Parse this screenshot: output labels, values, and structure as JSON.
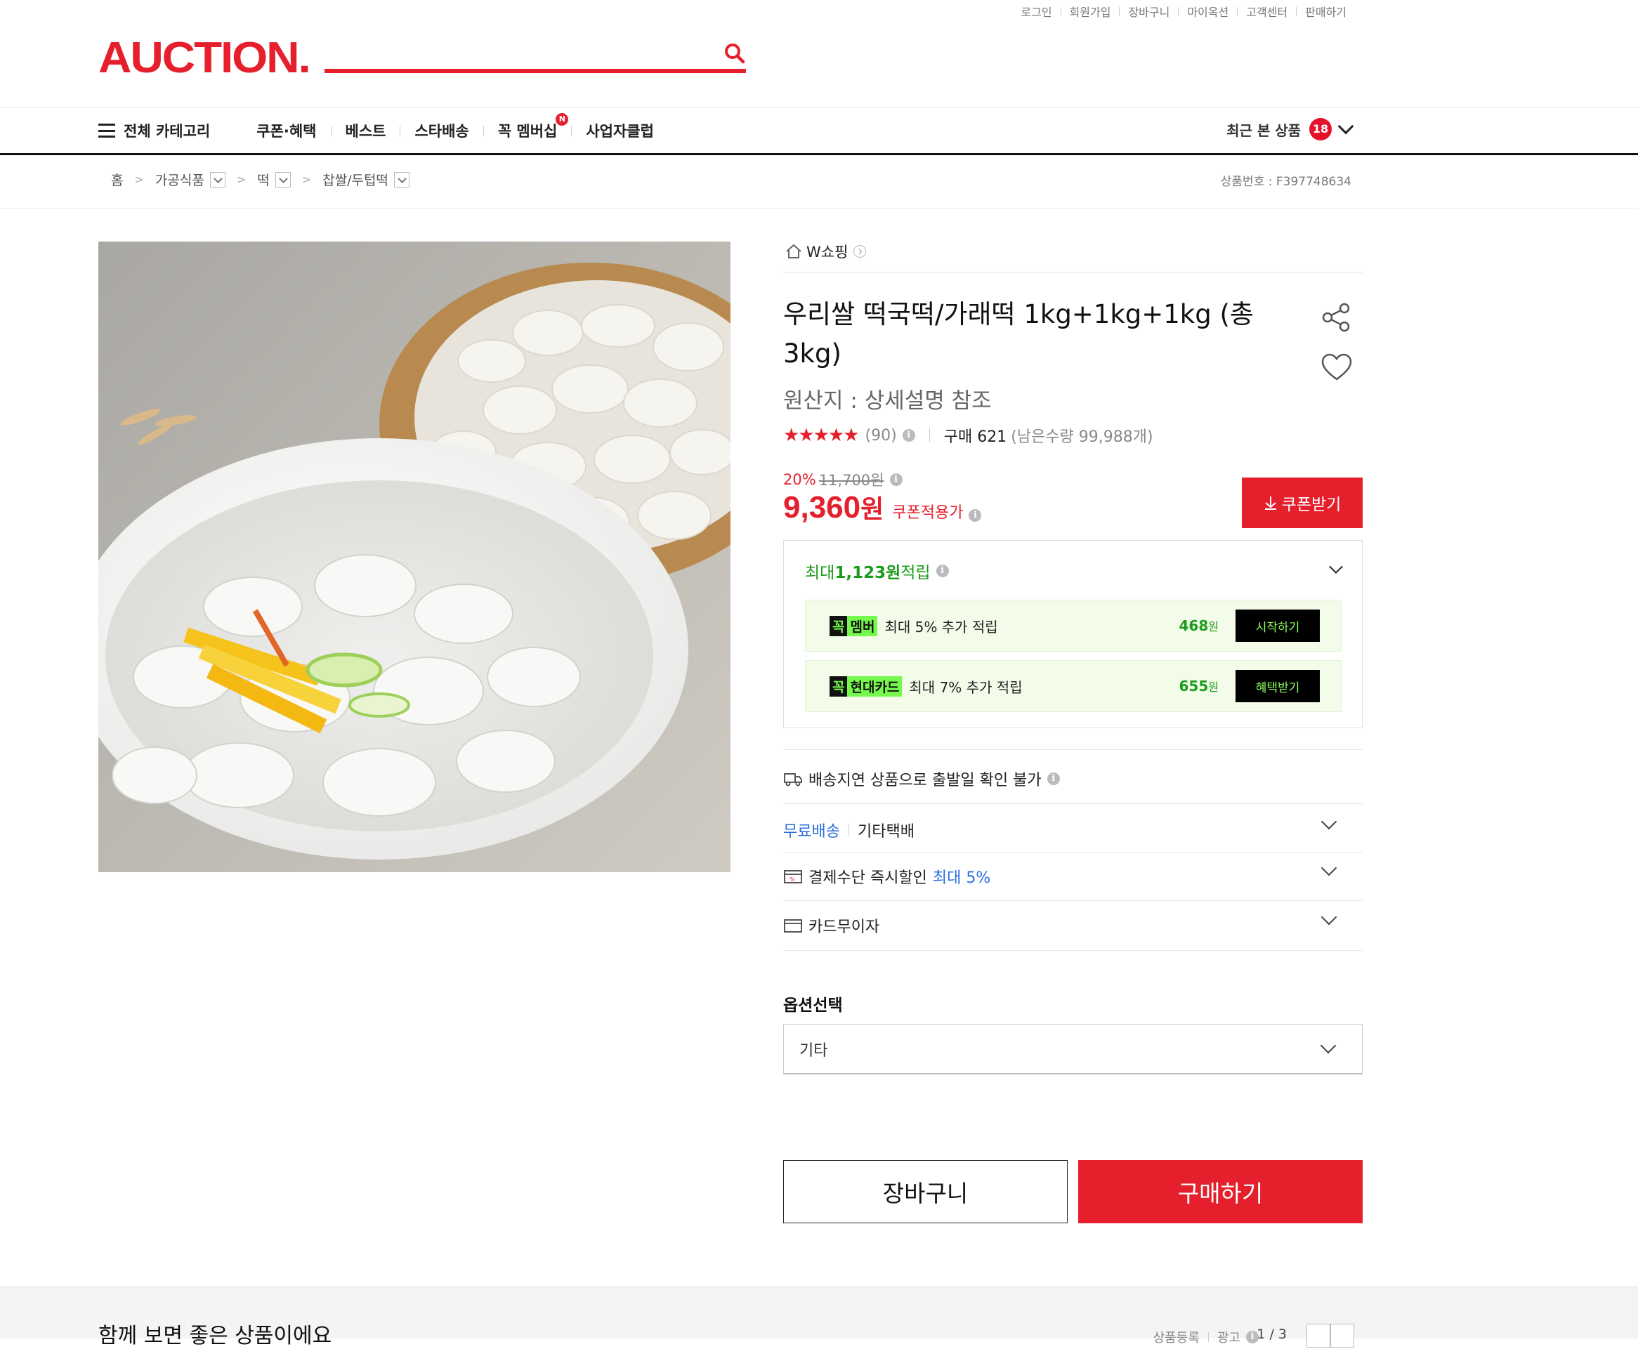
{
  "util_links": [
    "로그인",
    "회원가입",
    "장바구니",
    "마이옥션",
    "고객센터",
    "판매하기"
  ],
  "logo": "AUCTION.",
  "nav": {
    "categories": "전체 카테고리",
    "items": [
      "쿠폰·혜택",
      "베스트",
      "스타배송",
      "꼭 멤버십",
      "사업자클럽"
    ],
    "membership_badge": "N",
    "recent_label": "최근 본 상품",
    "recent_count": "18"
  },
  "breadcrumb": [
    "홈",
    "가공식품",
    "떡",
    "찹쌀/두텁떡"
  ],
  "product_number": "상품번호 : F397748634",
  "store_name": "W쇼핑",
  "product": {
    "title": "우리쌀 떡국떡/가래떡 1kg+1kg+1kg (총 3kg)",
    "origin": "원산지 : 상세설명 참조",
    "rating": 4.5,
    "stars": "★★★★★",
    "review_count": "(90)",
    "purchase": "구매 621",
    "stock": "(남은수량 99,988개)",
    "discount_pct": "20%",
    "original_price": "11,700원",
    "price": "9,360",
    "price_unit": "원",
    "price_label": "쿠폰적용가",
    "coupon_button": "쿠폰받기"
  },
  "reward": {
    "prefix": "최대 ",
    "amount": "1,123원",
    "suffix": " 적립",
    "rows": [
      {
        "tag_k": "꼭",
        "tag_m": "멤버",
        "text": "최대 5% 추가 적립",
        "amount": "468",
        "unit": "원",
        "button": "시작하기"
      },
      {
        "tag_k": "꼭",
        "tag_m": "현대카드",
        "text": "최대 7% 추가 적립",
        "amount": "655",
        "unit": "원",
        "button": "혜택받기"
      }
    ]
  },
  "shipping": {
    "delay_text": "배송지연 상품으로 출발일 확인 불가",
    "free": "무료배송",
    "carrier": "기타택배",
    "payment_discount": "결제수단 즉시할인",
    "payment_max": "최대 5%",
    "installment": "카드무이자"
  },
  "option": {
    "label": "옵션선택",
    "selected": "기타"
  },
  "buttons": {
    "cart": "장바구니",
    "buy": "구매하기"
  },
  "bottom": {
    "heading": "함께 보면 좋은 상품이에요",
    "meta": "상품등록",
    "ad": "광고",
    "page": "1 / 3"
  },
  "colors": {
    "brand": "#e5202c",
    "reward_green": "#1a9c1a",
    "link_blue": "#2b6de0"
  }
}
